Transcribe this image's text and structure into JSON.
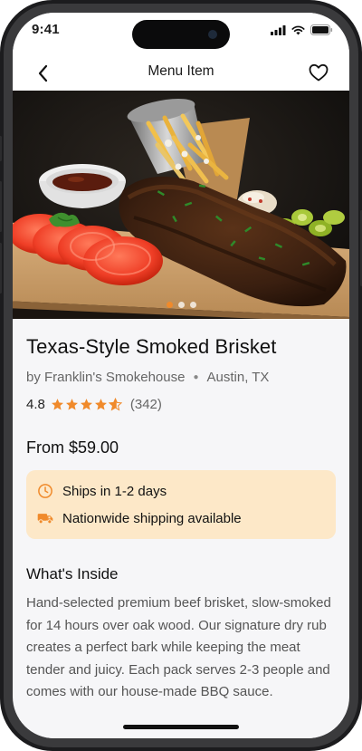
{
  "status_bar": {
    "time": "9:41"
  },
  "nav": {
    "title": "Menu Item"
  },
  "gallery": {
    "image_alt": "Smoked brisket on a wooden board with tomatoes, BBQ sauce, fries and pickles",
    "dot_count": 3,
    "active_index": 0
  },
  "product": {
    "title": "Texas-Style Smoked Brisket",
    "vendor": "by Franklin's Smokehouse",
    "separator": "●",
    "location": "Austin, TX",
    "rating": "4.8",
    "rating_value": 4.8,
    "rating_max": 5,
    "review_count": "(342)",
    "price": "From $59.00"
  },
  "shipping": {
    "eta": "Ships in 1-2 days",
    "coverage": "Nationwide shipping available"
  },
  "description": {
    "heading": "What's Inside",
    "body": "Hand-selected premium beef brisket, slow-smoked for 14 hours over oak wood. Our signature dry rub creates a perfect bark while keeping the meat tender and juicy. Each pack serves 2-3 people and comes with our house-made BBQ sauce."
  },
  "colors": {
    "accent": "#f08a2b",
    "shipping_bg": "#fde8c8",
    "text_primary": "#111111",
    "text_secondary": "#666666"
  }
}
